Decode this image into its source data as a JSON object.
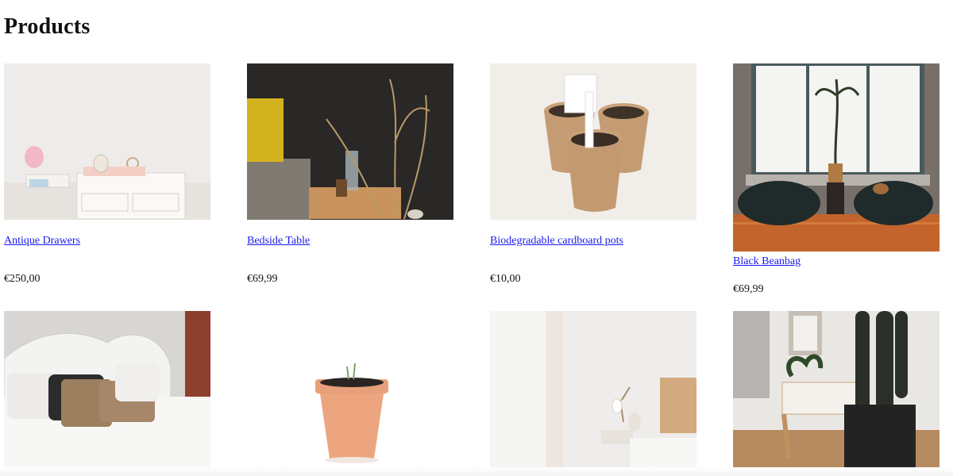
{
  "page": {
    "title": "Products"
  },
  "products": [
    {
      "name": "Antique Drawers",
      "price": "€250,00",
      "image": "antique-drawers-image"
    },
    {
      "name": "Bedside Table",
      "price": "€69,99",
      "image": "bedside-table-image"
    },
    {
      "name": "Biodegradable cardboard pots",
      "price": "€10,00",
      "image": "cardboard-pots-image"
    },
    {
      "name": "Black Beanbag",
      "price": "€69,99",
      "image": "black-beanbag-image"
    },
    {
      "image": "bed-pillows-image"
    },
    {
      "image": "terracotta-pot-image"
    },
    {
      "image": "bedroom-lamp-image"
    },
    {
      "image": "cactus-chair-image"
    }
  ]
}
